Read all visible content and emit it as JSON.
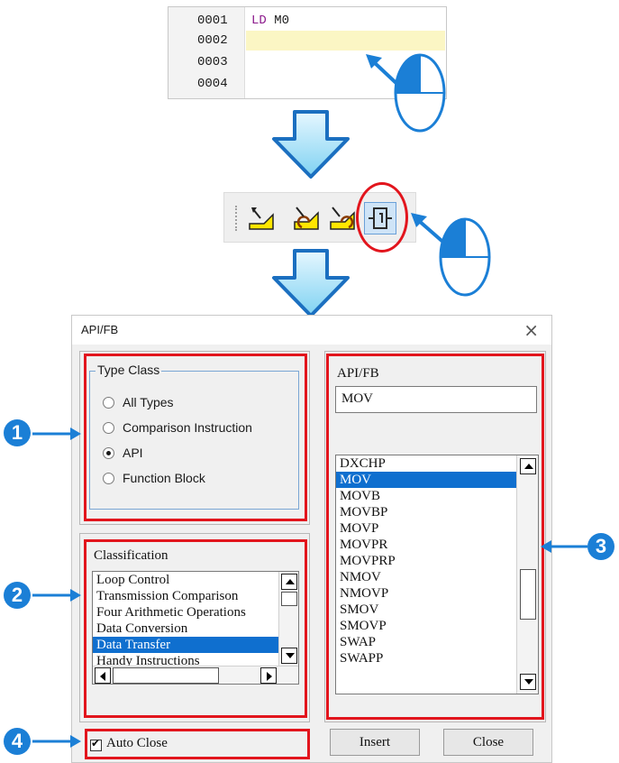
{
  "editor": {
    "lines": [
      {
        "num": "0001",
        "keyword": "LD",
        "operand": "M0"
      },
      {
        "num": "0002",
        "keyword": "",
        "operand": ""
      },
      {
        "num": "0003",
        "keyword": "",
        "operand": ""
      },
      {
        "num": "0004",
        "keyword": "",
        "operand": ""
      }
    ]
  },
  "icons": {
    "mouse": "mouse-left-click-icon",
    "step_arrow": "down-arrow-icon",
    "toolbar": [
      "ladder-input-icon",
      "ladder-undo-icon",
      "ladder-redo-icon",
      "api-fb-instruction-icon"
    ]
  },
  "dialog": {
    "title": "API/FB",
    "close_glyph": "×",
    "type_class": {
      "legend": "Type Class",
      "options": [
        "All Types",
        "Comparison Instruction",
        "API",
        "Function Block"
      ],
      "selected": "API"
    },
    "classification": {
      "label": "Classification",
      "items": [
        "Loop Control",
        "Transmission Comparison",
        "Four Arithmetic Operations",
        "Data Conversion",
        "Data Transfer",
        "Handy Instructions"
      ],
      "selected": "Data Transfer"
    },
    "api_fb": {
      "label": "API/FB",
      "value": "MOV",
      "items": [
        "DXCHP",
        "MOV",
        "MOVB",
        "MOVBP",
        "MOVP",
        "MOVPR",
        "MOVPRP",
        "NMOV",
        "NMOVP",
        "SMOV",
        "SMOVP",
        "SWAP",
        "SWAPP"
      ],
      "selected": "MOV"
    },
    "auto_close": {
      "label": "Auto Close",
      "checked": true
    },
    "buttons": {
      "insert": "Insert",
      "close": "Close"
    }
  },
  "callouts": [
    "1",
    "2",
    "3",
    "4"
  ],
  "colors": {
    "highlight_red": "#e2151d",
    "callout_blue": "#1b7fd6",
    "selection_blue": "#0f6fcf",
    "editor_line_highlight": "#fbf6c4",
    "keyword_purple": "#8c1a8c"
  }
}
